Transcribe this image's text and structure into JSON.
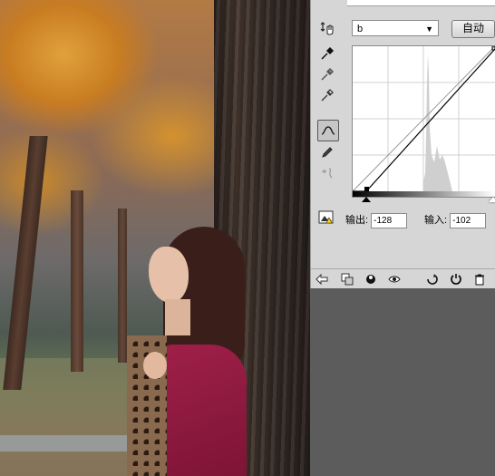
{
  "panel": {
    "channel": {
      "value": "b"
    },
    "auto_label": "自动",
    "output": {
      "label": "输出:",
      "value": "-128"
    },
    "input": {
      "label": "输入:",
      "value": "-102"
    },
    "curve_point": {
      "input": -102,
      "output": -128
    }
  },
  "tools": [
    {
      "icon": "on-image-adjust-icon"
    },
    {
      "icon": "eyedropper-black-icon"
    },
    {
      "icon": "eyedropper-gray-icon"
    },
    {
      "icon": "eyedropper-white-icon"
    },
    {
      "icon": "curve-edit-icon",
      "active": true
    },
    {
      "icon": "pencil-icon"
    },
    {
      "icon": "smooth-curve-icon"
    }
  ],
  "bottom_icons": [
    "back-arrow-icon",
    "clip-layer-icon",
    "visibility-eye-icon",
    "view-previous-icon",
    "reset-icon",
    "delete-icon",
    "trash-icon"
  ]
}
